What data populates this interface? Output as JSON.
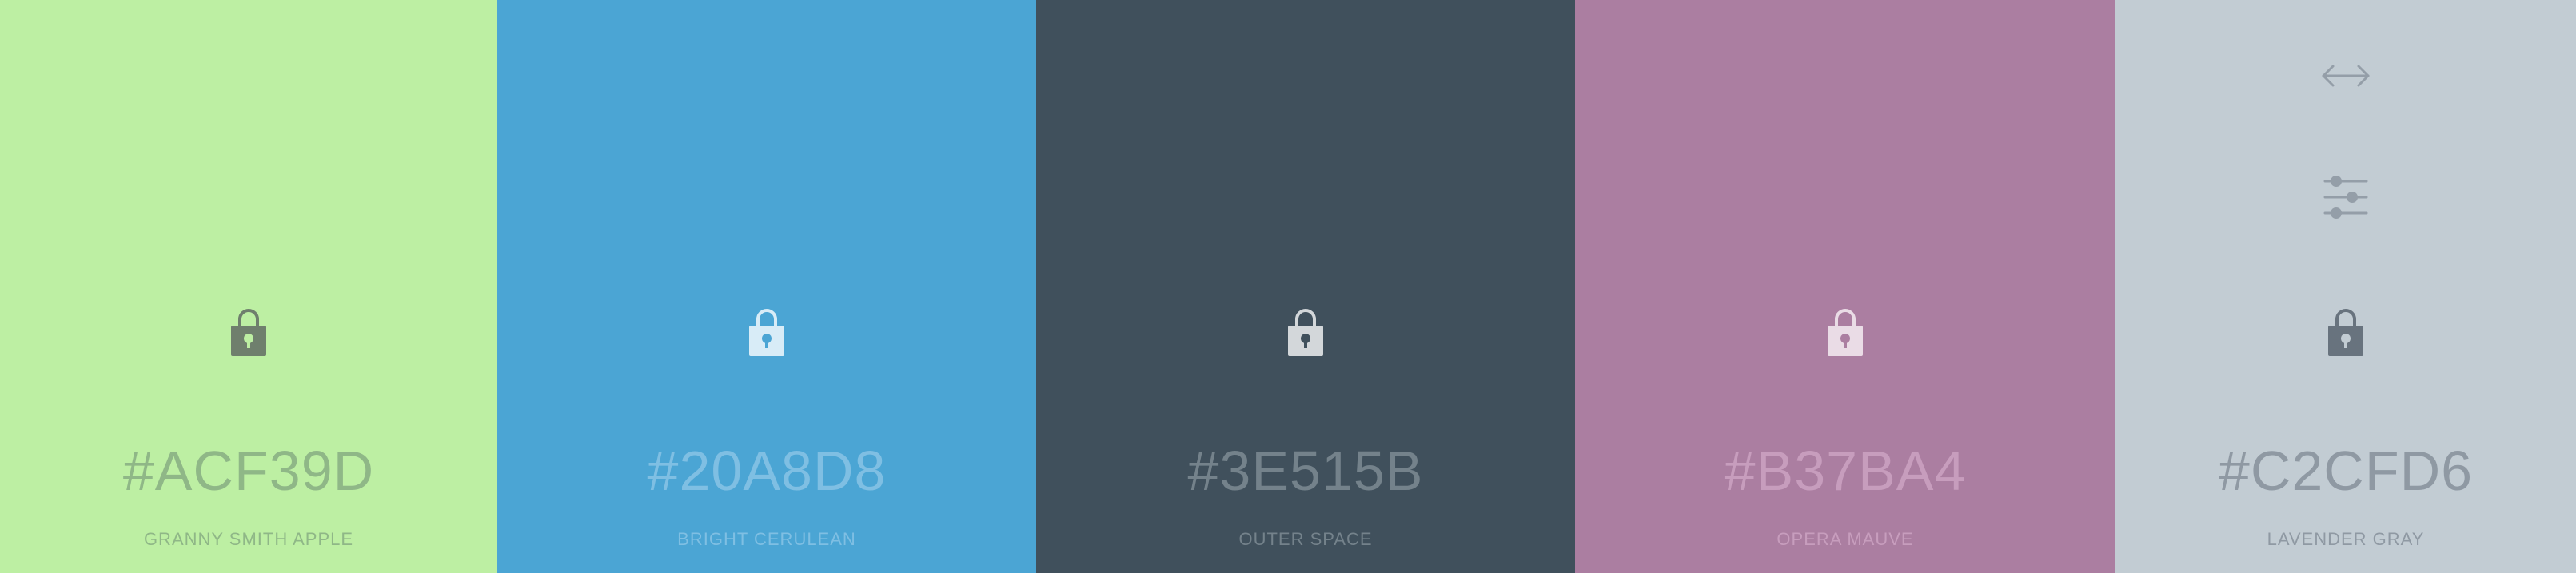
{
  "swatches": [
    {
      "hex": "#ACF39D",
      "name": "GRANNY SMITH APPLE",
      "bg": "#BDEFA3",
      "text": "#8FB787",
      "lock": "#6F7F6D",
      "dot": "#BDEFA3"
    },
    {
      "hex": "#20A8D8",
      "name": "BRIGHT CERULEAN",
      "bg": "#4BA5D4",
      "text": "#7FBFE3",
      "lock": "#D8ECF7",
      "dot": "#4BA5D4"
    },
    {
      "hex": "#3E515B",
      "name": "OUTER SPACE",
      "bg": "#40505C",
      "text": "#74828B",
      "lock": "#D3D7DA",
      "dot": "#40505C"
    },
    {
      "hex": "#B37BA4",
      "name": "OPERA MAUVE",
      "bg": "#AB7EA1",
      "text": "#C79DBD",
      "lock": "#EADCE6",
      "dot": "#AB7EA1"
    },
    {
      "hex": "#C2CFD6",
      "name": "LAVENDER GRAY",
      "bg": "#C2CCD3",
      "text": "#8F99A3",
      "lock": "#68737E",
      "dot": "#C2CCD3"
    }
  ],
  "tools": {
    "arrows_icon": "left-right-arrows-icon",
    "adjust_icon": "sliders-adjust-icon",
    "color": "#949EA8"
  }
}
